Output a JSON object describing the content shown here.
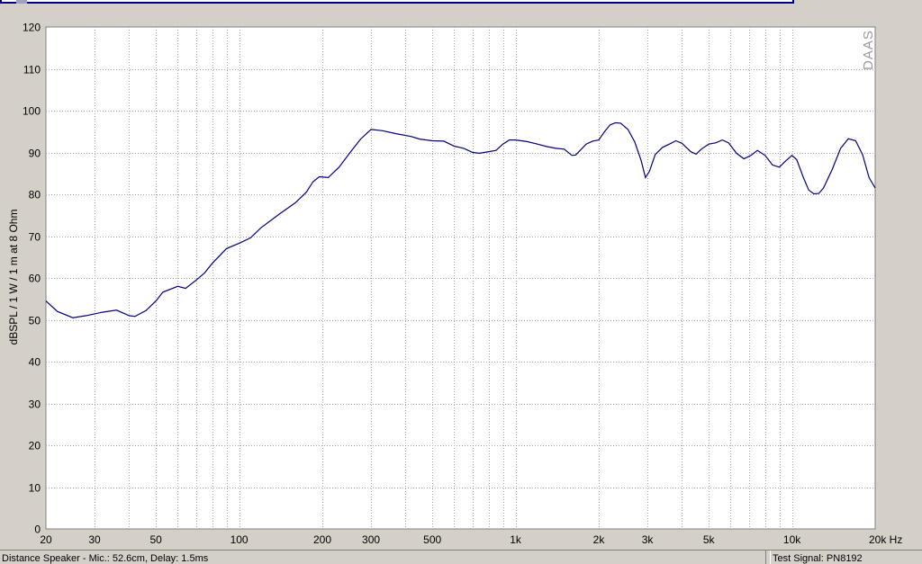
{
  "chart_data": {
    "type": "line",
    "ylabel": "dBSPL / 1 W / 1 m at 8 Ohm",
    "x_scale": "log",
    "xlim": [
      20,
      20000
    ],
    "ylim": [
      0,
      120
    ],
    "grid": true,
    "x_tick_labels": [
      {
        "value": 20,
        "label": "20"
      },
      {
        "value": 30,
        "label": "30"
      },
      {
        "value": 50,
        "label": "50"
      },
      {
        "value": 100,
        "label": "100"
      },
      {
        "value": 200,
        "label": "200"
      },
      {
        "value": 300,
        "label": "300"
      },
      {
        "value": 500,
        "label": "500"
      },
      {
        "value": 1000,
        "label": "1k"
      },
      {
        "value": 2000,
        "label": "2k"
      },
      {
        "value": 3000,
        "label": "3k"
      },
      {
        "value": 5000,
        "label": "5k"
      },
      {
        "value": 10000,
        "label": "10k"
      },
      {
        "value": 20000,
        "label": "20k Hz"
      }
    ],
    "y_ticks": [
      0,
      10,
      20,
      30,
      40,
      50,
      60,
      70,
      80,
      90,
      100,
      110,
      120
    ],
    "watermark": "DAAS",
    "series": [
      {
        "color": "#000080",
        "points": [
          [
            20,
            54.5
          ],
          [
            22,
            52
          ],
          [
            25,
            50.5
          ],
          [
            28,
            51
          ],
          [
            32,
            51.8
          ],
          [
            36,
            52.3
          ],
          [
            40,
            51
          ],
          [
            42,
            50.8
          ],
          [
            46,
            52.2
          ],
          [
            50,
            54.5
          ],
          [
            53,
            56.6
          ],
          [
            60,
            58
          ],
          [
            64,
            57.5
          ],
          [
            70,
            59.5
          ],
          [
            75,
            61.2
          ],
          [
            80,
            63.5
          ],
          [
            90,
            67
          ],
          [
            100,
            68.3
          ],
          [
            110,
            69.6
          ],
          [
            120,
            72
          ],
          [
            140,
            75.3
          ],
          [
            160,
            78
          ],
          [
            175,
            80.5
          ],
          [
            185,
            83
          ],
          [
            195,
            84.2
          ],
          [
            210,
            84
          ],
          [
            230,
            86.5
          ],
          [
            250,
            89.7
          ],
          [
            275,
            93.2
          ],
          [
            300,
            95.5
          ],
          [
            330,
            95.2
          ],
          [
            370,
            94.5
          ],
          [
            420,
            93.8
          ],
          [
            450,
            93.2
          ],
          [
            500,
            92.8
          ],
          [
            550,
            92.7
          ],
          [
            600,
            91.5
          ],
          [
            650,
            91
          ],
          [
            700,
            90
          ],
          [
            740,
            89.8
          ],
          [
            800,
            90.2
          ],
          [
            850,
            90.5
          ],
          [
            900,
            92
          ],
          [
            950,
            93
          ],
          [
            1000,
            93
          ],
          [
            1100,
            92.6
          ],
          [
            1200,
            92
          ],
          [
            1300,
            91.4
          ],
          [
            1400,
            91
          ],
          [
            1500,
            90.8
          ],
          [
            1600,
            89.3
          ],
          [
            1650,
            89.4
          ],
          [
            1800,
            92
          ],
          [
            1900,
            92.7
          ],
          [
            2000,
            93
          ],
          [
            2100,
            95
          ],
          [
            2200,
            96.6
          ],
          [
            2300,
            97.1
          ],
          [
            2400,
            97
          ],
          [
            2550,
            95.5
          ],
          [
            2700,
            92.5
          ],
          [
            2850,
            88
          ],
          [
            2950,
            84
          ],
          [
            3050,
            85.5
          ],
          [
            3200,
            89.5
          ],
          [
            3400,
            91.2
          ],
          [
            3600,
            92
          ],
          [
            3800,
            92.8
          ],
          [
            4000,
            92.2
          ],
          [
            4300,
            90.2
          ],
          [
            4500,
            89.6
          ],
          [
            4700,
            90.8
          ],
          [
            5000,
            92
          ],
          [
            5300,
            92.3
          ],
          [
            5600,
            93
          ],
          [
            5900,
            92.3
          ],
          [
            6300,
            89.8
          ],
          [
            6700,
            88.5
          ],
          [
            7100,
            89.3
          ],
          [
            7500,
            90.5
          ],
          [
            8000,
            89.3
          ],
          [
            8500,
            87
          ],
          [
            9000,
            86.5
          ],
          [
            9500,
            88
          ],
          [
            10000,
            89.3
          ],
          [
            10400,
            88.3
          ],
          [
            11000,
            84
          ],
          [
            11500,
            81
          ],
          [
            12000,
            80.1
          ],
          [
            12500,
            80.2
          ],
          [
            13000,
            81.5
          ],
          [
            14000,
            86
          ],
          [
            15000,
            91
          ],
          [
            16000,
            93.3
          ],
          [
            17000,
            92.8
          ],
          [
            18000,
            89.5
          ],
          [
            19000,
            84
          ],
          [
            20000,
            81.5
          ]
        ]
      }
    ]
  },
  "status": {
    "left": "Distance Speaker - Mic.: 52.6cm, Delay: 1.5ms",
    "right": "Test Signal: PN8192"
  }
}
